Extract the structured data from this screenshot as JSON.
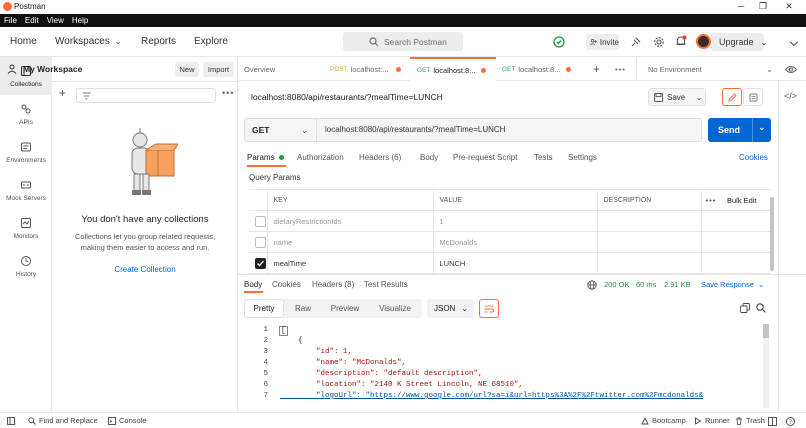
{
  "window": {
    "title": "Postman"
  },
  "menu": [
    "File",
    "Edit",
    "View",
    "Help"
  ],
  "header": {
    "nav": [
      "Home",
      "Workspaces",
      "Reports",
      "Explore"
    ],
    "search_placeholder": "Search Postman",
    "invite": "Invite",
    "upgrade": "Upgrade"
  },
  "rail": [
    {
      "label": "Collections",
      "icon": "collections-icon"
    },
    {
      "label": "APIs",
      "icon": "apis-icon"
    },
    {
      "label": "Environments",
      "icon": "environments-icon"
    },
    {
      "label": "Mock Servers",
      "icon": "mock-servers-icon"
    },
    {
      "label": "Monitors",
      "icon": "monitors-icon"
    },
    {
      "label": "History",
      "icon": "history-icon"
    }
  ],
  "workspace": {
    "name": "My Workspace",
    "new_label": "New",
    "import_label": "Import",
    "empty_title": "You don't have any collections",
    "empty_body_1": "Collections let you group related requests,",
    "empty_body_2": "making them easier to access and run.",
    "create_link": "Create Collection"
  },
  "tabs": {
    "overview": "Overview",
    "items": [
      {
        "method": "POST",
        "label": "localhost:..."
      },
      {
        "method": "GET",
        "label": "localhost:8..."
      },
      {
        "method": "GET",
        "label": "localhost:8..."
      }
    ],
    "environment": "No Environment"
  },
  "request": {
    "title": "localhost:8080/api/restaurants/?mealTime=LUNCH",
    "save_label": "Save",
    "method": "GET",
    "url": "localhost:8080/api/restaurants/?mealTime=LUNCH",
    "send_label": "Send",
    "subtabs": [
      "Params",
      "Authorization",
      "Headers (6)",
      "Body",
      "Pre-request Script",
      "Tests",
      "Settings"
    ],
    "cookies_label": "Cookies",
    "query_params_label": "Query Params",
    "table_headers": [
      "KEY",
      "VALUE",
      "DESCRIPTION"
    ],
    "bulk_edit": "Bulk Edit",
    "params": [
      {
        "checked": false,
        "key": "dietaryRestrictionIds",
        "value": "1"
      },
      {
        "checked": false,
        "key": "name",
        "value": "McDonalds"
      },
      {
        "checked": true,
        "key": "mealTime",
        "value": "LUNCH"
      }
    ]
  },
  "response": {
    "tabs": [
      "Body",
      "Cookies",
      "Headers (8)",
      "Test Results"
    ],
    "status": "200 OK",
    "time": "60 ms",
    "size": "2.91 KB",
    "save_response": "Save Response",
    "views": [
      "Pretty",
      "Raw",
      "Preview",
      "Visualize"
    ],
    "format": "JSON",
    "lines": [
      {
        "n": "1",
        "text": "["
      },
      {
        "n": "2",
        "text": "    {"
      },
      {
        "n": "3",
        "text": "        \"id\": 1,"
      },
      {
        "n": "4",
        "text": "        \"name\": \"McDonalds\","
      },
      {
        "n": "5",
        "text": "        \"description\": \"default description\","
      },
      {
        "n": "6",
        "text": "        \"location\": \"2140 K Street Lincoln, NE 68510\","
      },
      {
        "n": "7",
        "text": "        \"logoUrl\": \"https://www.google.com/url?sa=i&url=https%3A%2F%2Ftwitter.com%2Fmcdonalds&"
      }
    ]
  },
  "statusbar": {
    "left": [
      "Find and Replace",
      "Console"
    ],
    "right": [
      "Bootcamp",
      "Runner",
      "Trash"
    ]
  }
}
